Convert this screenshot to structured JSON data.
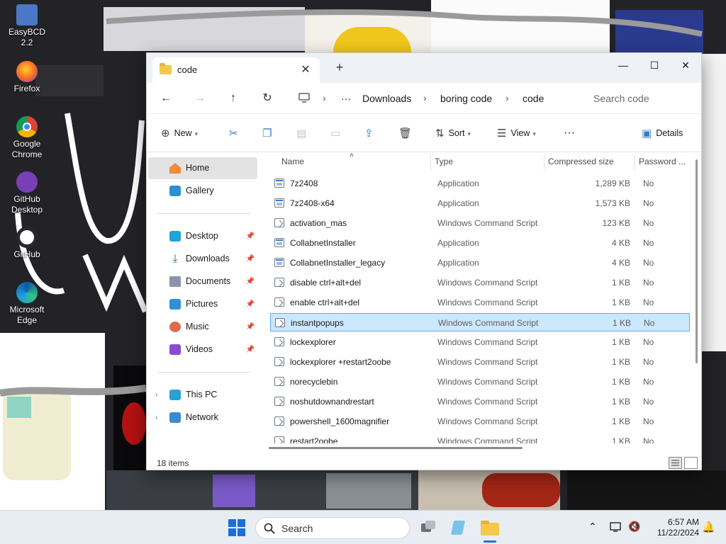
{
  "desktop": {
    "icons": [
      {
        "label": "EasyBCD 2.2"
      },
      {
        "label": "Firefox"
      },
      {
        "label": "Google Chrome"
      },
      {
        "label": "GitHub Desktop"
      },
      {
        "label": "GitHub"
      },
      {
        "label": "Microsoft Edge"
      }
    ]
  },
  "window": {
    "tab": {
      "title": "code",
      "icon": "folder-icon"
    },
    "controls": {
      "minimize": "—",
      "maximize": "☐",
      "close": "✕"
    },
    "breadcrumb": {
      "overflow": "···",
      "items": [
        "Downloads",
        "boring code",
        "code"
      ]
    },
    "search": {
      "placeholder": "Search code"
    },
    "commands": {
      "new": "New",
      "sort": "Sort",
      "view": "View",
      "more": "···",
      "details": "Details"
    }
  },
  "nav": {
    "items": [
      {
        "label": "Home",
        "icon": "home-icon",
        "selected": true
      },
      {
        "label": "Gallery",
        "icon": "gallery-icon"
      },
      {
        "label": "Desktop",
        "icon": "desktop-icon",
        "pinned": true
      },
      {
        "label": "Downloads",
        "icon": "download-icon",
        "pinned": true
      },
      {
        "label": "Documents",
        "icon": "documents-icon",
        "pinned": true
      },
      {
        "label": "Pictures",
        "icon": "pictures-icon",
        "pinned": true
      },
      {
        "label": "Music",
        "icon": "music-icon",
        "pinned": true
      },
      {
        "label": "Videos",
        "icon": "videos-icon",
        "pinned": true
      },
      {
        "label": "This PC",
        "icon": "pc-icon"
      },
      {
        "label": "Network",
        "icon": "network-icon"
      }
    ]
  },
  "filelist": {
    "columns": [
      "Name",
      "Type",
      "Compressed size",
      "Password ..."
    ],
    "rows": [
      {
        "name": "7z2408",
        "type": "Application",
        "size": "1,289 KB",
        "password": "No",
        "kind": "app"
      },
      {
        "name": "7z2408-x64",
        "type": "Application",
        "size": "1,573 KB",
        "password": "No",
        "kind": "app"
      },
      {
        "name": "activation_mas",
        "type": "Windows Command Script",
        "size": "123 KB",
        "password": "No",
        "kind": "cmd"
      },
      {
        "name": "CollabnetInstaller",
        "type": "Application",
        "size": "4 KB",
        "password": "No",
        "kind": "app"
      },
      {
        "name": "CollabnetInstaller_legacy",
        "type": "Application",
        "size": "4 KB",
        "password": "No",
        "kind": "app"
      },
      {
        "name": "disable ctrl+alt+del",
        "type": "Windows Command Script",
        "size": "1 KB",
        "password": "No",
        "kind": "cmd"
      },
      {
        "name": "enable ctrl+alt+del",
        "type": "Windows Command Script",
        "size": "1 KB",
        "password": "No",
        "kind": "cmd"
      },
      {
        "name": "instantpopups",
        "type": "Windows Command Script",
        "size": "1 KB",
        "password": "No",
        "kind": "cmd",
        "selected": true
      },
      {
        "name": "lockexplorer",
        "type": "Windows Command Script",
        "size": "1 KB",
        "password": "No",
        "kind": "cmd"
      },
      {
        "name": "lockexplorer +restart2oobe",
        "type": "Windows Command Script",
        "size": "1 KB",
        "password": "No",
        "kind": "cmd"
      },
      {
        "name": "norecyclebin",
        "type": "Windows Command Script",
        "size": "1 KB",
        "password": "No",
        "kind": "cmd"
      },
      {
        "name": "noshutdownandrestart",
        "type": "Windows Command Script",
        "size": "1 KB",
        "password": "No",
        "kind": "cmd"
      },
      {
        "name": "powershell_1600magnifier",
        "type": "Windows Command Script",
        "size": "1 KB",
        "password": "No",
        "kind": "cmd"
      },
      {
        "name": "restart2oobe",
        "type": "Windows Command Script",
        "size": "1 KB",
        "password": "No",
        "kind": "cmd"
      }
    ]
  },
  "status": {
    "item_count": "18 items"
  },
  "taskbar": {
    "search_placeholder": "Search",
    "time": "6:57 AM",
    "date": "11/22/2024"
  }
}
